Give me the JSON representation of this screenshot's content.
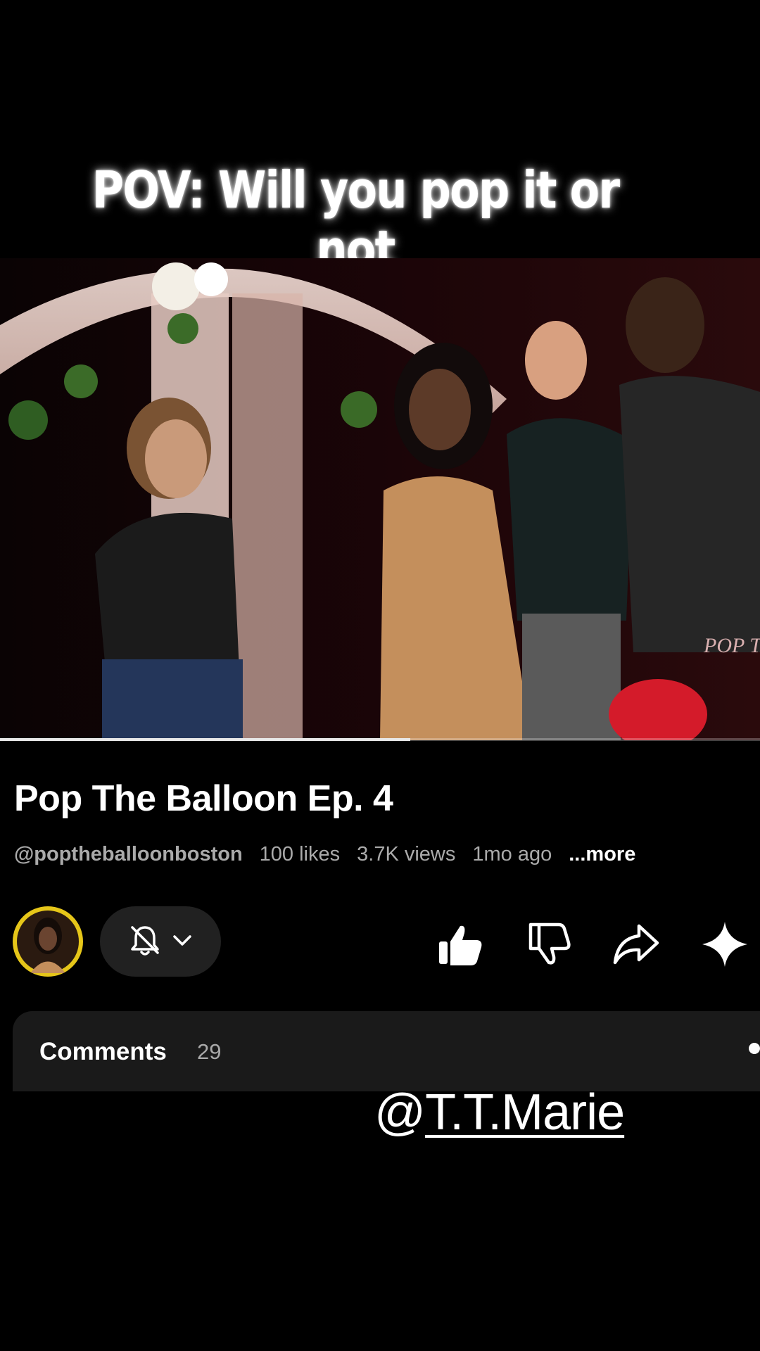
{
  "overlay": {
    "caption": "POV: Will you pop it or not"
  },
  "video": {
    "watermark": "POP The Ballo",
    "progress_fraction": 0.54
  },
  "details": {
    "title": "Pop The Balloon Ep. 4",
    "channel": "@poptheballoonboston",
    "likes": "100 likes",
    "views": "3.7K views",
    "age": "1mo ago",
    "more_label": "...more"
  },
  "actions": {
    "avatar_icon": "channel-avatar",
    "subscribe_icons": [
      "bell-off-icon",
      "chevron-down-icon"
    ],
    "buttons": [
      "thumbs-up-icon",
      "thumbs-down-icon",
      "share-icon",
      "sparkle-icon"
    ]
  },
  "comments": {
    "label": "Comments",
    "count": "29"
  },
  "credit": {
    "at": "@",
    "name": "T.T.Marie"
  },
  "colors": {
    "background": "#000000",
    "avatar_ring": "#e6c619",
    "pill": "#212121",
    "card": "#1a1a1a",
    "meta_text": "#aaaaaa"
  }
}
